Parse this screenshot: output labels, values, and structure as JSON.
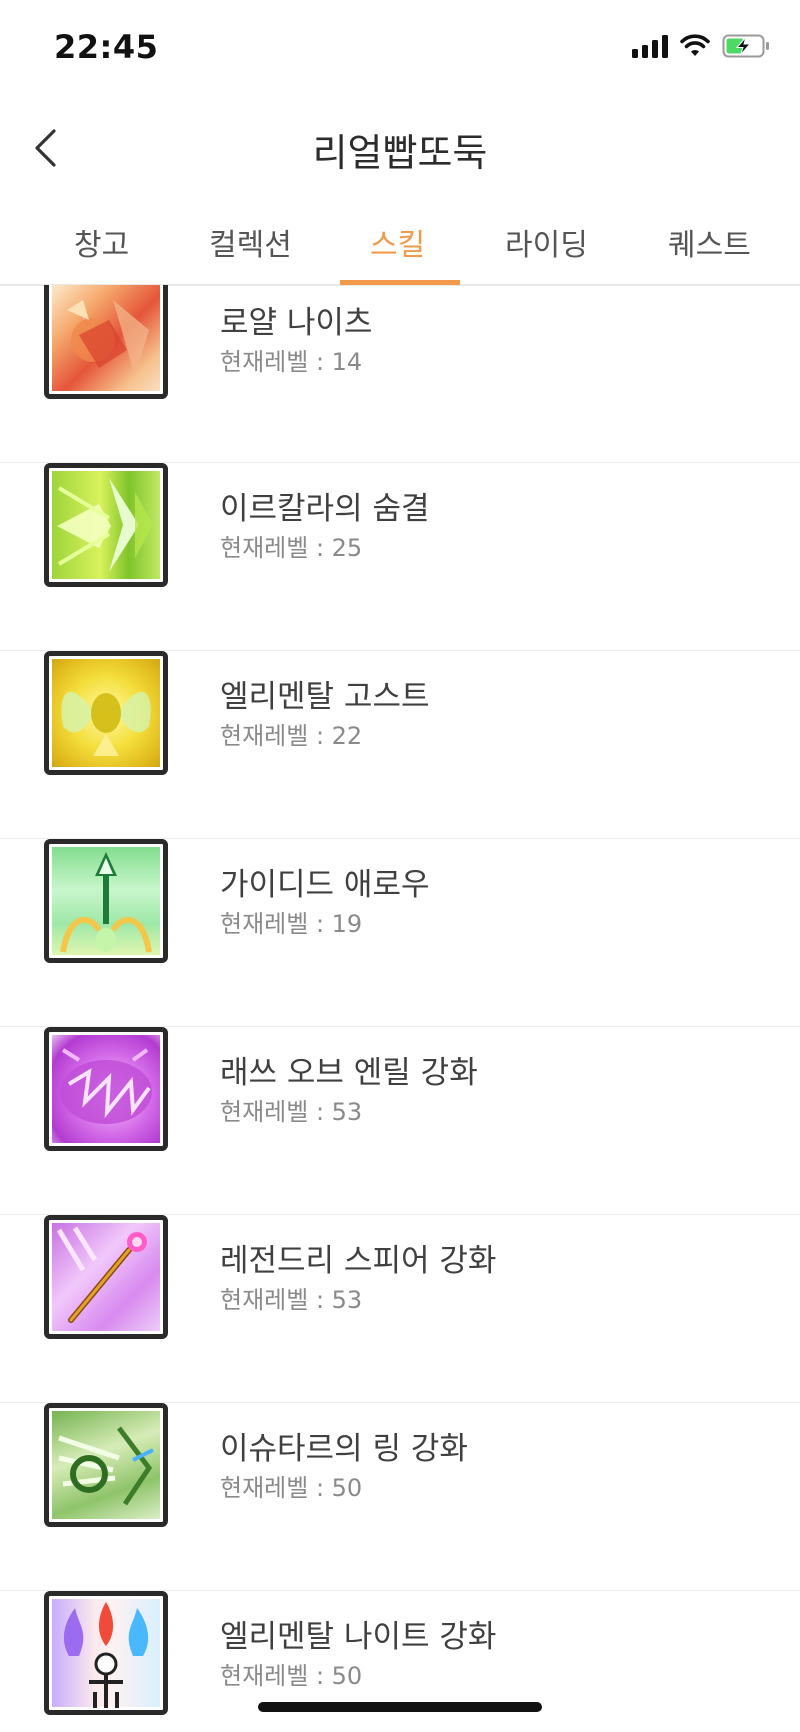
{
  "status_bar": {
    "time": "22:45"
  },
  "header": {
    "title": "리얼빱또둑"
  },
  "tabs": [
    {
      "label": "창고"
    },
    {
      "label": "컬렉션"
    },
    {
      "label": "스킬"
    },
    {
      "label": "라이딩"
    },
    {
      "label": "퀘스트"
    }
  ],
  "active_tab": "스킬",
  "colors": {
    "accent": "#f39a4a",
    "text": "#404040",
    "subtext": "#8a8a8a",
    "divider": "#efefef"
  },
  "skills": [
    {
      "name": "로얄 나이츠",
      "level": "현재레벨 : 14",
      "icon": "royal-knights-skill-icon"
    },
    {
      "name": "이르칼라의 숨결",
      "level": "현재레벨 : 25",
      "icon": "irkalla-breath-skill-icon"
    },
    {
      "name": "엘리멘탈 고스트",
      "level": "현재레벨 : 22",
      "icon": "elemental-ghost-skill-icon"
    },
    {
      "name": "가이디드 애로우",
      "level": "현재레벨 : 19",
      "icon": "guided-arrow-skill-icon"
    },
    {
      "name": "래쓰 오브 엔릴 강화",
      "level": "현재레벨 : 53",
      "icon": "wrath-of-enlil-skill-icon"
    },
    {
      "name": "레전드리 스피어 강화",
      "level": "현재레벨 : 53",
      "icon": "legendary-spear-skill-icon"
    },
    {
      "name": "이슈타르의 링 강화",
      "level": "현재레벨 : 50",
      "icon": "ishtar-ring-skill-icon"
    },
    {
      "name": "엘리멘탈 나이트 강화",
      "level": "현재레벨 : 50",
      "icon": "elemental-knights-skill-icon"
    }
  ]
}
